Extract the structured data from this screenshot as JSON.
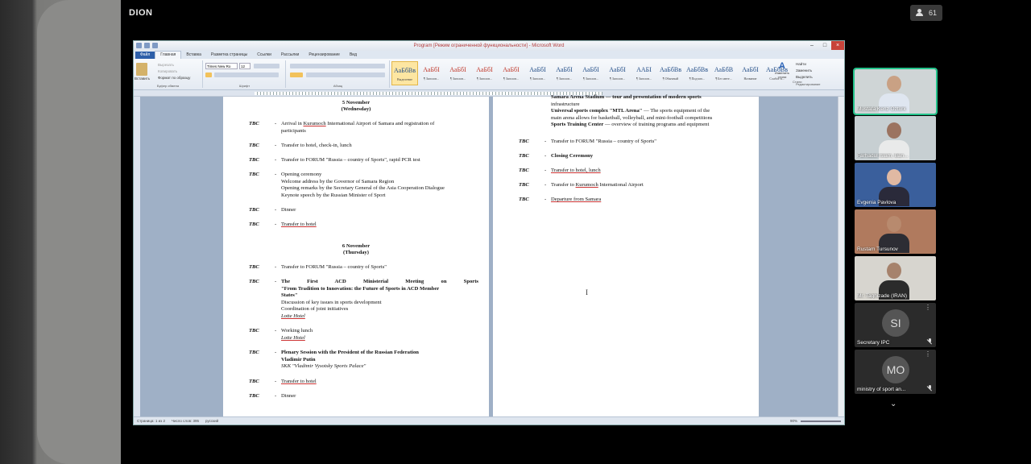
{
  "app": {
    "logo": "DION",
    "participants_count": "61"
  },
  "word": {
    "title": "Program [Режим ограниченной функциональности] - Microsoft Word",
    "tabs": [
      "Файл",
      "Главная",
      "Вставка",
      "Разметка страницы",
      "Ссылки",
      "Рассылки",
      "Рецензирование",
      "Вид"
    ],
    "ribbon": {
      "clipboard": {
        "paste": "Вставить",
        "cut": "Вырезать",
        "copy": "Копировать",
        "format_painter": "Формат по образцу",
        "group": "Буфер обмена"
      },
      "font": {
        "name": "Times New Ro",
        "size": "12",
        "group": "Шрифт"
      },
      "paragraph_group": "Абзац",
      "styles": [
        {
          "preview": "АаБбВв",
          "name": "Выделение"
        },
        {
          "preview": "АаБбІ",
          "name": "¶ Заголов..."
        },
        {
          "preview": "АаБбІ",
          "name": "¶ Заголов..."
        },
        {
          "preview": "АаБбІ",
          "name": "¶ Заголов..."
        },
        {
          "preview": "АаБбІ",
          "name": "¶ Заголов..."
        },
        {
          "preview": "АаБбІ",
          "name": "¶ Заголов..."
        },
        {
          "preview": "АаБбІ",
          "name": "¶ Заголов..."
        },
        {
          "preview": "АаБбІ",
          "name": "¶ Заголов..."
        },
        {
          "preview": "АаБбІ",
          "name": "¶ Заголов..."
        },
        {
          "preview": "ААБІ",
          "name": "¶ Заголов..."
        },
        {
          "preview": "АаБбВв",
          "name": "¶ Обычный"
        },
        {
          "preview": "АаБбВв",
          "name": "¶ Подзаго..."
        },
        {
          "preview": "АаБбВ",
          "name": "¶ Без инте..."
        },
        {
          "preview": "АаБбІ",
          "name": "Название"
        },
        {
          "preview": "АаБбВв",
          "name": "Слабое в..."
        }
      ],
      "styles_group": "Стили",
      "change_styles": "Изменить стили",
      "editing": {
        "find": "Найти",
        "replace": "Заменить",
        "select": "Выделить",
        "group": "Редактирование"
      }
    },
    "status": {
      "page": "Страница: 1 из 2",
      "words": "Число слов: 395",
      "lang": "русский",
      "zoom": "90%"
    }
  },
  "doc": {
    "day1_title": "5 November",
    "day1_sub": "(Wednesday)",
    "day2_title": "6 November",
    "day2_sub": "(Thursday)",
    "tbc": "TBC",
    "dash": "-",
    "d1_1a": "Arrival in",
    "d1_1b": "Kurumoch",
    "d1_1c": "International Airport of Samara and registration of",
    "d1_1d": "participants",
    "d1_2": "Transfer to hotel, check-in, lunch",
    "d1_3": "Transfer to FORUM \"Russia – country of Sports\", rapid PCR test",
    "d1_4a": "Opening ceremony",
    "d1_4b": "Welcome address by the Governor of Samara Region",
    "d1_4c": "Opening remarks by the Secretary General of the Asia Cooperation Dialogue",
    "d1_4d": "Keynote speech by the Russian Minister of Sport",
    "d1_5": "Dinner",
    "d1_6": "Transfer to hotel",
    "d2_1": "Transfer to FORUM \"Russia – country of Sports\"",
    "d2_2a": "The First ACD Ministerial Meeting on Sports",
    "d2_2b": "\"From Tradition to Innovation: the Future of Sports in ACD Member",
    "d2_2c": "States\"",
    "d2_2d": "Discussion of key issues in sports development",
    "d2_2e": "Coordination of joint initiatives",
    "d2_2f": "Lotte Hotel",
    "d2_3a": "Working lunch",
    "d2_3b": "Lotte Hotel",
    "d2_4a": "Plenary Session with the President of the Russian Federation",
    "d2_4b": "Vladimir Putin",
    "d2_4c": "SKK \"Vladimir Vysotsky Sports Palace\"",
    "d2_5": "Transfer to hotel",
    "d2_6": "Dinner",
    "p2_0a": "Samara Arena Stadium — tour and presentation of modern sports",
    "p2_0b": "infrastructure",
    "p2_1a": "Universal sports complex \"MTL Arena\"",
    "p2_1b": "— The sports equipment of the",
    "p2_1c": "main arena allows for basketball, volleyball, and mini-football competitions",
    "p2_1d": "Sports Training Center",
    "p2_1e": "— overview of training programs and equipment",
    "p2_2": "Transfer to FORUM \"Russia – country of Sports\"",
    "p2_3": "Closing Ceremony",
    "p2_4": "Transfer to hotel, lunch",
    "p2_5a": "Transfer to",
    "p2_5b": "Kurumoch",
    "p2_5c": "International Airport",
    "p2_6": "Departure from Samara"
  },
  "participants": [
    {
      "name": "Mustafa Kenz Öztürk",
      "kind": "video",
      "skin": "#c9a184",
      "shirt": "#dfe6f0",
      "bg": "#cfd5d6"
    },
    {
      "name": "Farhadul Islam, Ban...",
      "kind": "video",
      "skin": "#9b7360",
      "shirt": "#e9eaea",
      "bg": "#c7cfd2"
    },
    {
      "name": "Evgenia Pavlova",
      "kind": "video",
      "skin": "#e0b9a3",
      "shirt": "#2a2a3a",
      "bg": "#3a5f9c"
    },
    {
      "name": "Rustam Tursunov",
      "kind": "video",
      "skin": "#b88a6e",
      "shirt": "#2d2d34",
      "bg": "#b07a5e"
    },
    {
      "name": "Mr. Taghizade (IRAN)",
      "kind": "video",
      "skin": "#a6826c",
      "shirt": "#2b2b2b",
      "bg": "#d7d5cf"
    },
    {
      "name": "Secretary IPC",
      "kind": "avatar",
      "initials": "SI"
    },
    {
      "name": "ministry of sport an...",
      "kind": "avatar",
      "initials": "MO"
    }
  ]
}
